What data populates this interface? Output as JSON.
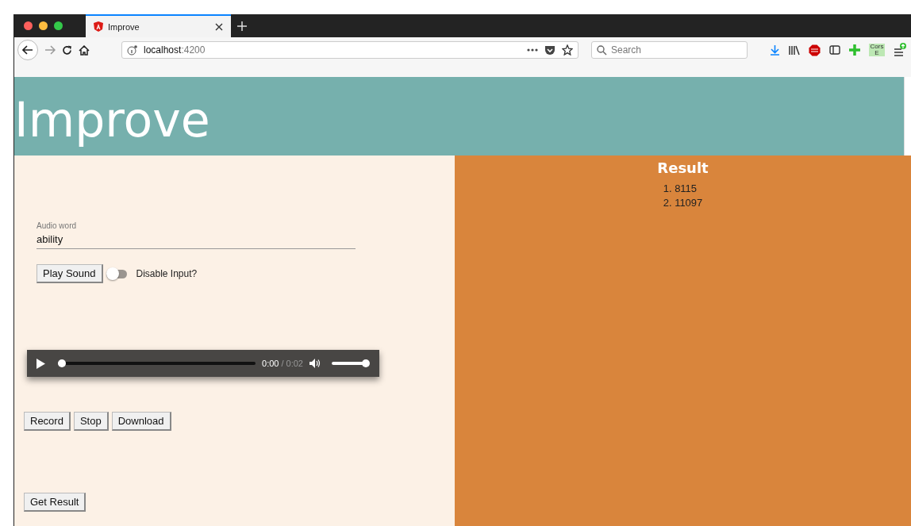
{
  "browser": {
    "tab": {
      "title": "Improve",
      "selected": true
    },
    "url": {
      "host": "localhost",
      "port": ":4200"
    },
    "search": {
      "placeholder": "Search"
    },
    "addon_badge": "Cors E"
  },
  "header": {
    "title": "Improve"
  },
  "form": {
    "field": {
      "label": "Audio word",
      "value": "ability"
    },
    "play_button": "Play Sound",
    "toggle": {
      "label": "Disable Input?",
      "on": false
    }
  },
  "player": {
    "current": "0:00",
    "duration": "/ 0:02",
    "progress": {
      "level": 0
    },
    "volume": {
      "level": 1
    }
  },
  "recorder_buttons": [
    "Record",
    "Stop",
    "Download"
  ],
  "result_button": "Get Result",
  "result": {
    "title": "Result",
    "items": [
      "1. 8115",
      "2. 11097"
    ]
  }
}
